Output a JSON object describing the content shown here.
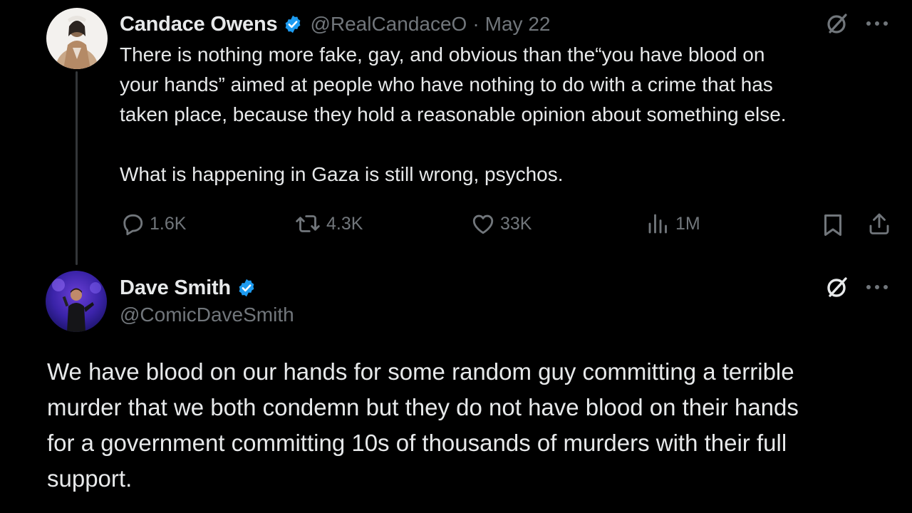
{
  "tweet1": {
    "name": "Candace Owens",
    "handle": "@RealCandaceO",
    "separator": "·",
    "date": "May 22",
    "lines": [
      "There is nothing more fake, gay, and obvious than the“you have blood on",
      "your hands” aimed at people who have nothing to do with a crime that has",
      "taken place, because they hold a reasonable opinion about something else."
    ],
    "line2": "What is happening in Gaza is still wrong, psychos.",
    "stats": {
      "replies": "1.6K",
      "reposts": "4.3K",
      "likes": "33K",
      "views": "1M"
    }
  },
  "tweet2": {
    "name": "Dave Smith",
    "handle": "@ComicDaveSmith",
    "lines": [
      "We have blood on our hands for some random guy committing a terrible",
      "murder that we both condemn but they do not have blood on their hands",
      "for a government committing 10s of thousands of murders with their full",
      "support."
    ]
  },
  "colors": {
    "background": "#000000",
    "text": "#e7e9ea",
    "muted": "#71767b",
    "verified": "#1d9bf0",
    "thread_line": "#333639"
  },
  "icons": {
    "verified": "verified-badge-icon",
    "grok": "grok-icon",
    "more": "more-dots-icon",
    "reply": "reply-icon",
    "repost": "repost-icon",
    "like": "heart-icon",
    "views": "views-chart-icon",
    "bookmark": "bookmark-icon",
    "share": "share-icon"
  }
}
